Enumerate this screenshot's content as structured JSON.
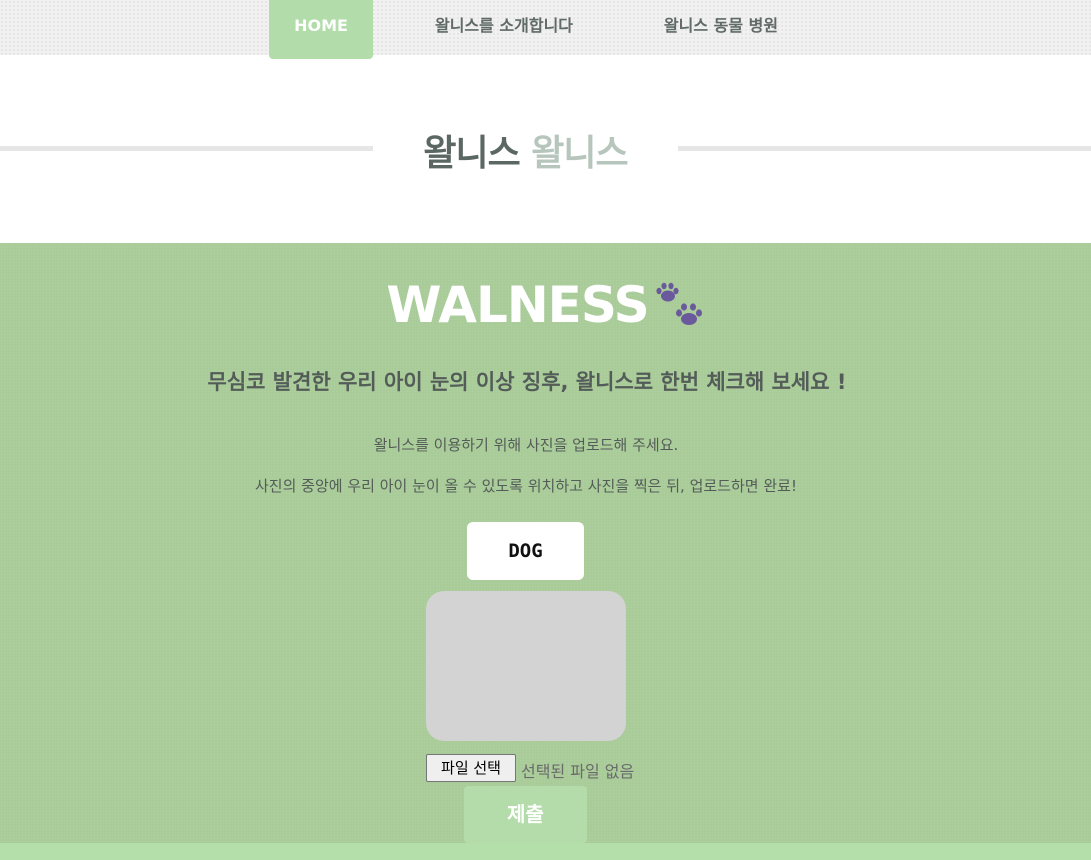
{
  "nav": {
    "items": [
      {
        "label": "HOME",
        "active": true
      },
      {
        "label": "왈니스를 소개합니다",
        "active": false
      },
      {
        "label": "왈니스 동물 병원",
        "active": false
      }
    ]
  },
  "title": {
    "part1": "왈니스",
    "part2": "왈니스"
  },
  "main": {
    "brand": "WALNESS",
    "brand_icon": "paw-prints-icon",
    "headline": "무심코 발견한 우리 아이 눈의 이상 징후, 왈니스로 한번 체크해 보세요 !",
    "instruction1": "왈니스를 이용하기 위해 사진을 업로드해 주세요.",
    "instruction2": "사진의 중앙에 우리 아이 눈이 올 수 있도록 위치하고 사진을 찍은 뒤, 업로드하면 완료!",
    "animal_button": "DOG",
    "file_button": "파일 선택",
    "file_status": "선택된 파일 없음",
    "submit_button": "제출"
  },
  "colors": {
    "accent_green": "#b2dca9",
    "section_green": "#a8cb98",
    "paw_purple": "#6a5a9c"
  }
}
